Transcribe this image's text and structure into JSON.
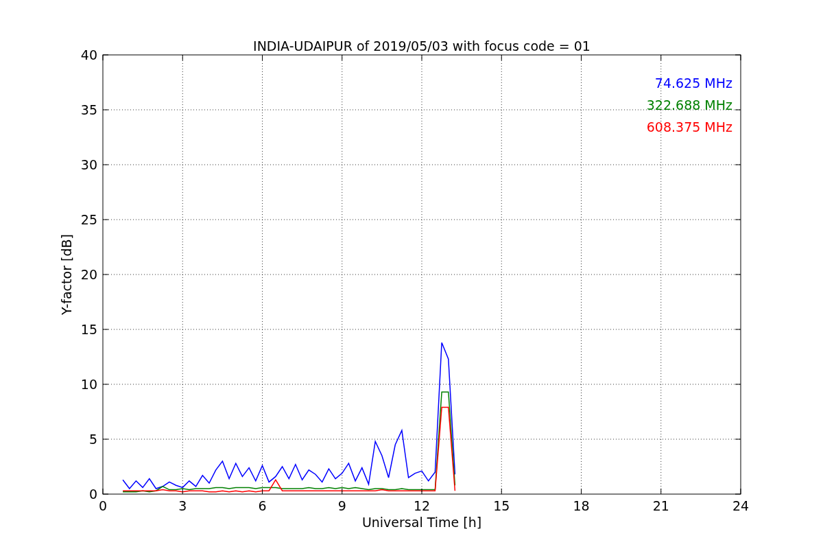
{
  "chart": {
    "chart_data": {
      "type": "line",
      "title": "INDIA-UDAIPUR of 2019/05/03 with focus code = 01",
      "xlabel": "Universal Time [h]",
      "ylabel": "Y-factor [dB]",
      "x": [
        0.75,
        1,
        1.25,
        1.5,
        1.75,
        2,
        2.25,
        2.5,
        2.75,
        3,
        3.25,
        3.5,
        3.75,
        4,
        4.25,
        4.5,
        4.75,
        5,
        5.25,
        5.5,
        5.75,
        6,
        6.25,
        6.5,
        6.75,
        7,
        7.25,
        7.5,
        7.75,
        8,
        8.25,
        8.5,
        8.75,
        9,
        9.25,
        9.5,
        9.75,
        10,
        10.25,
        10.5,
        10.75,
        11,
        11.25,
        11.5,
        11.75,
        12,
        12.25,
        12.5,
        12.75,
        13,
        13.25
      ],
      "series": [
        {
          "name": "74.625 MHz",
          "color": "#0000ff",
          "values": [
            1.3,
            0.5,
            1.2,
            0.6,
            1.4,
            0.5,
            0.7,
            1.1,
            0.8,
            0.6,
            1.2,
            0.7,
            1.7,
            1.0,
            2.2,
            3.0,
            1.4,
            2.8,
            1.6,
            2.4,
            1.2,
            2.6,
            1.1,
            1.6,
            2.5,
            1.4,
            2.7,
            1.3,
            2.2,
            1.8,
            1.1,
            2.3,
            1.4,
            1.9,
            2.8,
            1.2,
            2.4,
            0.9,
            4.8,
            3.5,
            1.5,
            4.5,
            5.8,
            1.5,
            1.9,
            2.1,
            1.2,
            2.0,
            13.8,
            12.3,
            1.8
          ]
        },
        {
          "name": "322.688 MHz",
          "color": "#008000",
          "values": [
            0.2,
            0.2,
            0.2,
            0.3,
            0.2,
            0.3,
            0.7,
            0.4,
            0.4,
            0.5,
            0.4,
            0.5,
            0.5,
            0.5,
            0.6,
            0.6,
            0.5,
            0.6,
            0.6,
            0.6,
            0.5,
            0.6,
            0.6,
            0.6,
            0.5,
            0.5,
            0.5,
            0.5,
            0.6,
            0.5,
            0.5,
            0.6,
            0.5,
            0.6,
            0.5,
            0.6,
            0.5,
            0.4,
            0.5,
            0.5,
            0.4,
            0.4,
            0.5,
            0.4,
            0.4,
            0.4,
            0.4,
            0.4,
            9.3,
            9.3,
            0.8
          ]
        },
        {
          "name": "608.375 MHz",
          "color": "#ff0000",
          "values": [
            0.3,
            0.3,
            0.3,
            0.3,
            0.3,
            0.3,
            0.4,
            0.3,
            0.3,
            0.2,
            0.3,
            0.3,
            0.3,
            0.2,
            0.2,
            0.3,
            0.2,
            0.3,
            0.2,
            0.3,
            0.2,
            0.3,
            0.3,
            1.3,
            0.3,
            0.3,
            0.3,
            0.3,
            0.3,
            0.3,
            0.3,
            0.3,
            0.3,
            0.3,
            0.3,
            0.3,
            0.3,
            0.3,
            0.3,
            0.4,
            0.3,
            0.3,
            0.3,
            0.3,
            0.3,
            0.3,
            0.3,
            0.3,
            7.9,
            7.9,
            0.3
          ]
        }
      ],
      "xlim": [
        0,
        24
      ],
      "ylim": [
        0,
        40
      ],
      "xticks": [
        0,
        3,
        6,
        9,
        12,
        15,
        18,
        21,
        24
      ],
      "yticks": [
        0,
        5,
        10,
        15,
        20,
        25,
        30,
        35,
        40
      ],
      "grid": true
    }
  }
}
